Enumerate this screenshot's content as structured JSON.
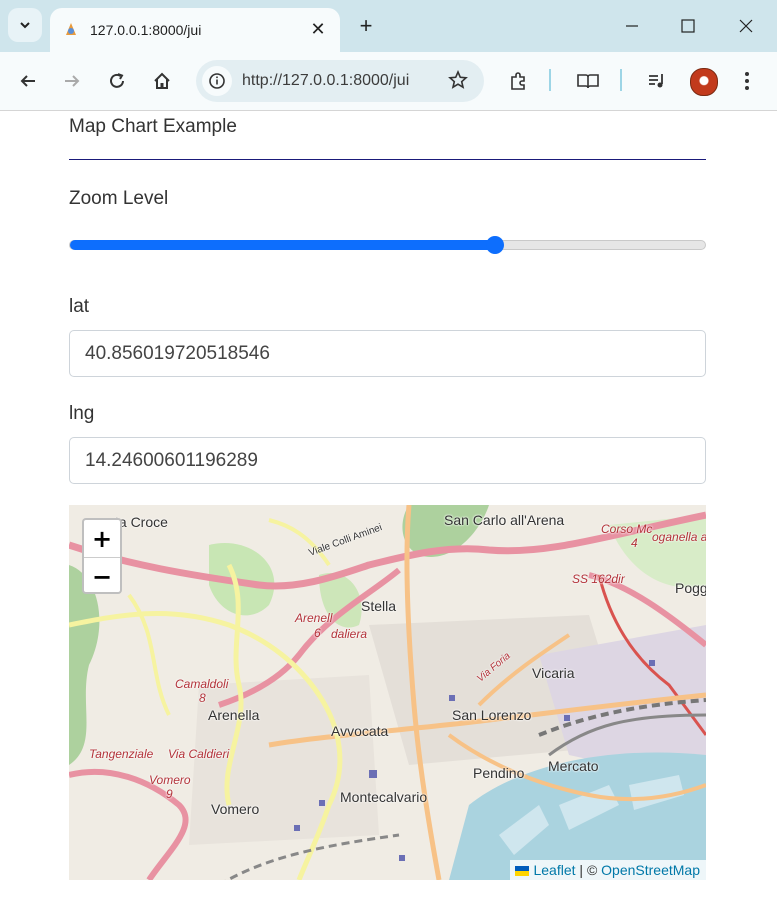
{
  "browser": {
    "tab_title": "127.0.0.1:8000/jui",
    "url": "http://127.0.0.1:8000/jui",
    "new_tab_label": "+",
    "close_label": "✕"
  },
  "page": {
    "title": "Map Chart Example",
    "zoom_label": "Zoom Level",
    "zoom_value_fraction": 0.67,
    "lat_label": "lat",
    "lat_value": "40.856019720518546",
    "lng_label": "lng",
    "lng_value": "14.24600601196289"
  },
  "map": {
    "zoom_in": "+",
    "zoom_out": "−",
    "attribution_sep": " | © ",
    "leaflet": "Leaflet",
    "osm": "OpenStreetMap",
    "places": [
      "ta Croce",
      "San Carlo all'Arena",
      "Viale Colli Aminei",
      "Corso Mc",
      "4",
      "oganella a",
      "SS 162dir",
      "Pogg",
      "Stella",
      "Arenell",
      "6",
      "daliera",
      "Via Foria",
      "Vicaria",
      "Camaldoli",
      "8",
      "Arenella",
      "Avvocata",
      "San Lorenzo",
      "Tangenziale",
      "Via Caldieri",
      "Vomero",
      "9",
      "Pendino",
      "Mercato",
      "Vomero",
      "Montecalvario"
    ]
  },
  "icons": [
    "chevron-down-icon",
    "favicon-icon",
    "close-icon",
    "minimize-icon",
    "maximize-icon",
    "window-close-icon",
    "back-icon",
    "forward-icon",
    "reload-icon",
    "home-icon",
    "info-icon",
    "star-icon",
    "extensions-icon",
    "reading-mode-icon",
    "media-icon",
    "menu-icon"
  ],
  "colors": {
    "accent": "#0d6efd",
    "tabbar": "#cfe5ec"
  }
}
